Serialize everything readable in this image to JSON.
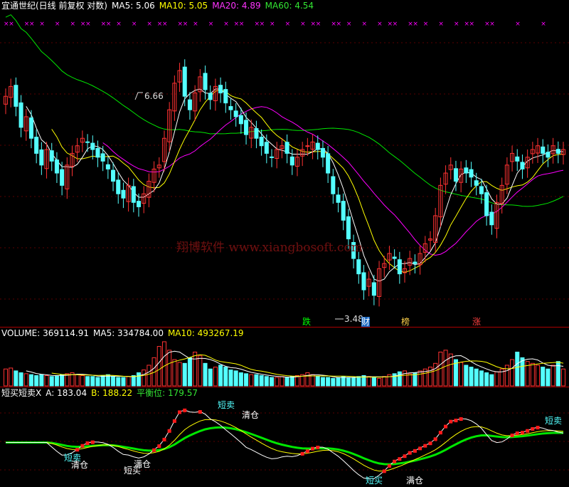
{
  "price_panel": {
    "title": "宜通世纪(日线 前复权 对数)",
    "ma5_label": "MA5: 5.06",
    "ma10_label": "MA10: 5.05",
    "ma20_label": "MA20: 4.89",
    "ma60_label": "MA60: 4.54",
    "high_label": "6.66",
    "low_label": "3.48",
    "watermark": "翔博软件 www.xiangbosoft.com",
    "markers": [
      "跌",
      "财",
      "榜",
      "涨"
    ],
    "colors": {
      "up": "#ff3232",
      "down": "#54ffff",
      "ma5": "#ffffff",
      "ma10": "#ffff00",
      "ma20": "#ff00ff",
      "ma60": "#00e600",
      "x_marks": "#ff00ff"
    }
  },
  "volume_panel": {
    "volume_label": "VOLUME: 369114.91",
    "ma5_label": "MA5: 334784.00",
    "ma10_label": "MA10: 493267.19"
  },
  "indicator_panel": {
    "title": "短买短卖X",
    "a_label": "A: 183.04",
    "b_label": "B: 188.22",
    "balance_label": "平衡位: 179.57",
    "annotations": [
      "短卖",
      "清仓",
      "短买",
      "满仓",
      "短卖",
      "清仓",
      "短买",
      "满仓",
      "短卖"
    ]
  },
  "chart_data": [
    {
      "type": "candlestick",
      "title": "宜通世纪(日线 前复权 对数)",
      "log_scale": true,
      "ylim": [
        3.3,
        7.3
      ],
      "high_marker": 6.66,
      "low_marker": 3.48,
      "series": [
        {
          "name": "MA5",
          "last": 5.06
        },
        {
          "name": "MA10",
          "last": 5.05
        },
        {
          "name": "MA20",
          "last": 4.89
        },
        {
          "name": "MA60",
          "last": 4.54
        }
      ],
      "close": [
        5.9,
        6.05,
        5.75,
        5.45,
        5.6,
        5.3,
        5.1,
        4.95,
        5.15,
        5.0,
        4.85,
        4.7,
        4.95,
        5.1,
        5.2,
        5.3,
        5.25,
        5.15,
        5.05,
        5.0,
        4.9,
        4.75,
        4.6,
        4.55,
        4.7,
        4.5,
        4.45,
        4.6,
        4.75,
        4.9,
        4.95,
        5.3,
        5.7,
        6.1,
        6.3,
        5.9,
        5.7,
        5.95,
        6.2,
        6.0,
        5.85,
        6.05,
        5.95,
        5.8,
        5.7,
        5.6,
        5.5,
        5.35,
        5.45,
        5.3,
        5.2,
        5.1,
        5.05,
        5.15,
        5.2,
        5.1,
        4.95,
        5.05,
        5.15,
        5.2,
        5.25,
        5.15,
        5.05,
        4.85,
        4.6,
        4.5,
        4.3,
        4.1,
        3.9,
        3.75,
        3.6,
        3.7,
        3.55,
        3.8,
        3.85,
        3.95,
        3.9,
        3.75,
        3.8,
        3.9,
        3.85,
        3.95,
        4.05,
        4.1,
        4.35,
        4.7,
        4.85,
        4.95,
        4.75,
        4.9,
        4.85,
        4.8,
        4.7,
        4.6,
        4.35,
        4.25,
        4.5,
        4.7,
        4.95,
        5.1,
        5.0,
        4.9,
        5.05,
        5.15,
        5.2,
        5.1,
        5.05,
        5.2,
        5.1,
        5.15
      ]
    },
    {
      "type": "bar",
      "title": "VOLUME",
      "value_last": 369114.91,
      "series": [
        {
          "name": "MA5",
          "last": 334784.0
        },
        {
          "name": "MA10",
          "last": 493267.19
        }
      ],
      "values": [
        18,
        19,
        16,
        14,
        13,
        12,
        11,
        12,
        11,
        10,
        11,
        12,
        13,
        14,
        12,
        11,
        10,
        10,
        9,
        11,
        12,
        10,
        9,
        9,
        10,
        11,
        14,
        17,
        22,
        30,
        42,
        47,
        38,
        28,
        25,
        24,
        30,
        36,
        32,
        24,
        18,
        20,
        22,
        20,
        17,
        16,
        14,
        13,
        12,
        12,
        11,
        10,
        9,
        9,
        10,
        9,
        10,
        11,
        12,
        14,
        12,
        10,
        9,
        9,
        8,
        9,
        10,
        9,
        9,
        10,
        11,
        10,
        9,
        8,
        10,
        12,
        13,
        15,
        16,
        13,
        14,
        16,
        18,
        20,
        24,
        36,
        38,
        34,
        28,
        25,
        22,
        20,
        18,
        16,
        14,
        12,
        15,
        18,
        22,
        28,
        36,
        30,
        26,
        24,
        22,
        20,
        18,
        22,
        26,
        18
      ],
      "ylim": [
        0,
        50
      ]
    },
    {
      "type": "line",
      "title": "短买短卖X",
      "series": [
        {
          "name": "A",
          "last": 183.04
        },
        {
          "name": "B",
          "last": 188.22
        },
        {
          "name": "平衡位",
          "last": 179.57
        }
      ]
    }
  ]
}
